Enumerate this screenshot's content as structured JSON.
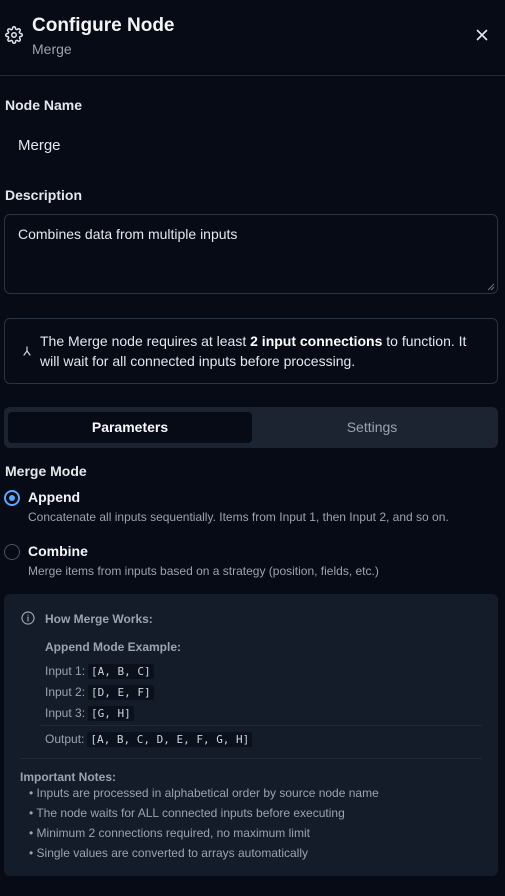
{
  "header": {
    "title": "Configure Node",
    "subtitle": "Merge",
    "icon": "gear-icon",
    "close_icon": "close-icon"
  },
  "node_name": {
    "label": "Node Name",
    "value": "Merge"
  },
  "description": {
    "label": "Description",
    "value": "Combines data from multiple inputs"
  },
  "info": {
    "icon": "merge-icon",
    "text_before": "The Merge node requires at least ",
    "text_bold": "2 input connections",
    "text_after": " to function. It will wait for all connected inputs before processing."
  },
  "tabs": [
    {
      "label": "Parameters",
      "active": true
    },
    {
      "label": "Settings",
      "active": false
    }
  ],
  "merge_mode": {
    "label": "Merge Mode",
    "selected": "Append",
    "options": [
      {
        "label": "Append",
        "description": "Concatenate all inputs sequentially. Items from Input 1, then Input 2, and so on."
      },
      {
        "label": "Combine",
        "description": "Merge items from inputs based on a strategy (position, fields, etc.)"
      }
    ]
  },
  "how_it_works": {
    "title": "How Merge Works:",
    "example_title": "Append Mode Example:",
    "examples": [
      {
        "label": "Input 1:",
        "value": "[A, B, C]"
      },
      {
        "label": "Input 2:",
        "value": "[D, E, F]"
      },
      {
        "label": "Input 3:",
        "value": "[G, H]"
      }
    ],
    "output": {
      "label": "Output:",
      "value": "[A, B, C, D, E, F, G, H]"
    },
    "notes_title": "Important Notes:",
    "notes": [
      "• Inputs are processed in alphabetical order by source node name",
      "• The node waits for ALL connected inputs before executing",
      "• Minimum 2 connections required, no maximum limit",
      "• Single values are converted to arrays automatically"
    ]
  },
  "colors": {
    "background": "#070b16",
    "accent": "#60a5fa",
    "panel": "#141c2a",
    "tab_track": "#1c2432"
  }
}
